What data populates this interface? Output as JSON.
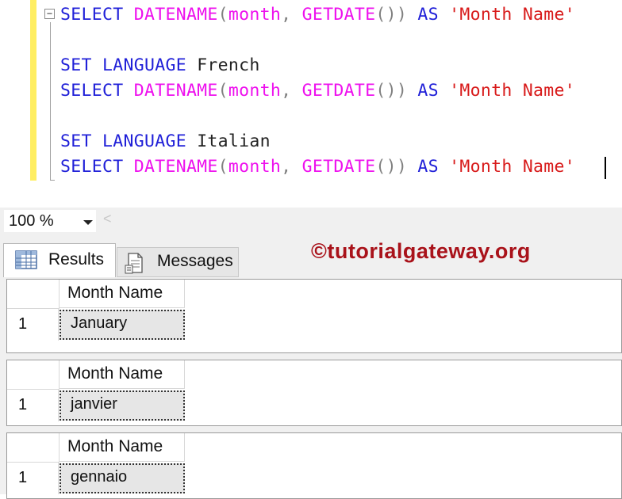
{
  "editor": {
    "lines": [
      {
        "kw1": "SELECT",
        "fn1": "DATENAME",
        "p1": "(",
        "arg": "month",
        "comma": ",",
        "fn2": "GETDATE",
        "p2": "())",
        "kw2": "AS",
        "str": "'Month Name'"
      },
      {
        "kw1": "SET",
        "kw2": "LANGUAGE",
        "id": "French"
      },
      {
        "kw1": "SELECT",
        "fn1": "DATENAME",
        "p1": "(",
        "arg": "month",
        "comma": ",",
        "fn2": "GETDATE",
        "p2": "())",
        "kw2": "AS",
        "str": "'Month Name'"
      },
      {
        "kw1": "SET",
        "kw2": "LANGUAGE",
        "id": "Italian"
      },
      {
        "kw1": "SELECT",
        "fn1": "DATENAME",
        "p1": "(",
        "arg": "month",
        "comma": ",",
        "fn2": "GETDATE",
        "p2": "())",
        "kw2": "AS",
        "str": "'Month Name'"
      }
    ],
    "collapse_glyph": "−"
  },
  "zoom": {
    "value": "100 %",
    "scroll_glyph": "<"
  },
  "tabs": {
    "results": "Results",
    "messages": "Messages"
  },
  "watermark": "©tutorialgateway.org",
  "grids": [
    {
      "header": "Month Name",
      "row": "1",
      "value": "January"
    },
    {
      "header": "Month Name",
      "row": "1",
      "value": "janvier"
    },
    {
      "header": "Month Name",
      "row": "1",
      "value": "gennaio"
    }
  ],
  "colors": {
    "keyword": "#2020d8",
    "function": "#ee10ee",
    "string": "#d81a1a",
    "change_bar": "#ffee62",
    "watermark": "#a9121a"
  }
}
